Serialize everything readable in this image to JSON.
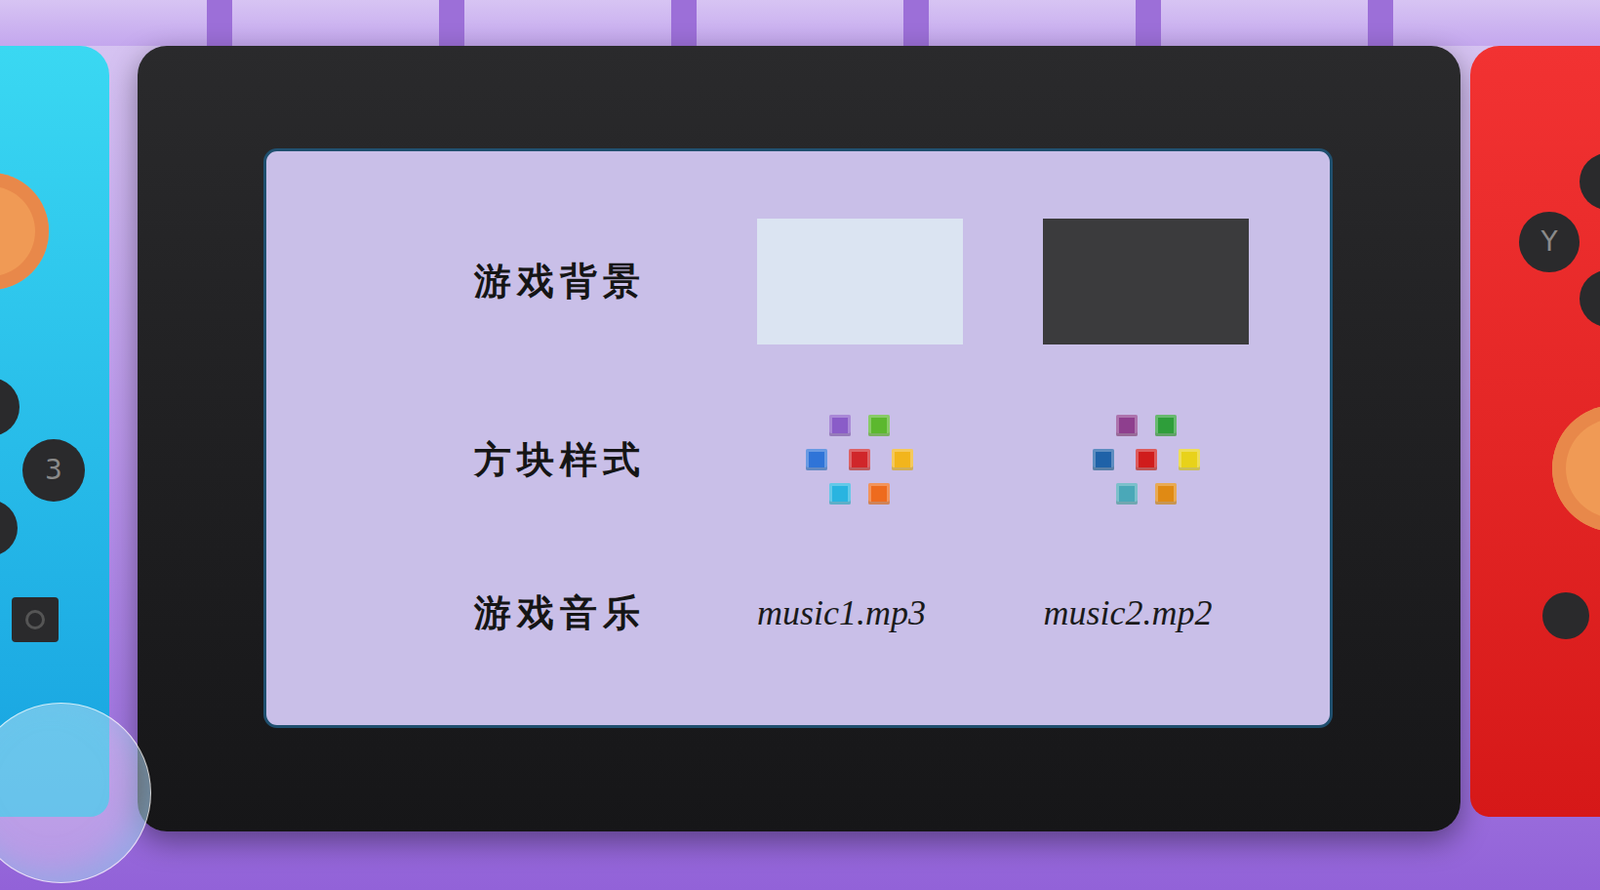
{
  "device": {
    "left_buttons": [
      "3"
    ],
    "right_buttons": [
      "Y"
    ]
  },
  "settings": [
    {
      "label": "游戏背景",
      "kind": "image",
      "options": [
        {
          "color": "#dbe4f2"
        },
        {
          "color": "#3b3b3d"
        }
      ]
    },
    {
      "label": "方块样式",
      "kind": "blocks",
      "options": [
        {
          "colors": [
            "#8a5cc8",
            "#5cb82e",
            "#2f74d8",
            "#d0262a",
            "#f2b51c",
            "#29b4e0",
            "#ee6b1e"
          ]
        },
        {
          "colors": [
            "#8e3f8e",
            "#2e9e3a",
            "#1f62a8",
            "#d01c1c",
            "#e8d21a",
            "#4aa8b8",
            "#e08a14"
          ]
        }
      ]
    },
    {
      "label": "游戏音乐",
      "kind": "text",
      "options": [
        {
          "text": "music1.mp3"
        },
        {
          "text": "music2.mp2"
        }
      ]
    }
  ]
}
